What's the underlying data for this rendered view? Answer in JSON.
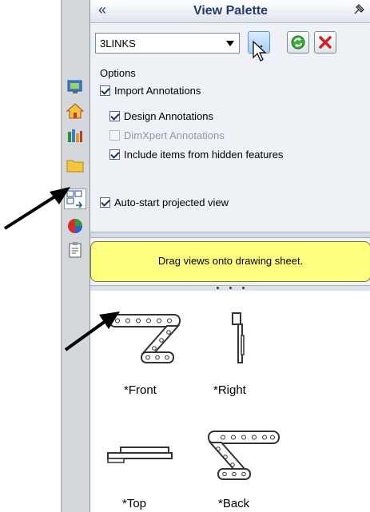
{
  "panel": {
    "title": "View Palette",
    "collapse_glyph": "«",
    "close_glyph": "✕",
    "pin_icon": "pushpin-icon"
  },
  "toolbar": {
    "drawing_dropdown": {
      "value": "3LINKS"
    },
    "buttons": [
      {
        "name": "browse-button",
        "icon": "ellipsis-icon",
        "tooltip": "..."
      },
      {
        "name": "refresh-button",
        "icon": "refresh-icon"
      },
      {
        "name": "clear-all-button",
        "icon": "red-x-icon"
      }
    ]
  },
  "options": {
    "label": "Options",
    "import_annotations": {
      "label": "Import Annotations",
      "checked": true
    },
    "design_annotations": {
      "label": "Design Annotations",
      "checked": true
    },
    "dimxpert_annotations": {
      "label": "DimXpert Annotations",
      "checked": false,
      "disabled": true
    },
    "include_hidden": {
      "label": "Include items from hidden features",
      "checked": true
    },
    "auto_start": {
      "label": "Auto-start projected view",
      "checked": true
    }
  },
  "hint": {
    "text": "Drag views onto drawing sheet."
  },
  "views": [
    {
      "label": "*Front",
      "icon": "front-view-thumbnail"
    },
    {
      "label": "*Right",
      "icon": "right-view-thumbnail"
    },
    {
      "label": "*Top",
      "icon": "top-view-thumbnail"
    },
    {
      "label": "*Back",
      "icon": "back-view-thumbnail"
    }
  ],
  "tabs": [
    {
      "name": "tab-solidworks-resources",
      "icon": "monitor-icon"
    },
    {
      "name": "tab-home",
      "icon": "house-icon"
    },
    {
      "name": "tab-design-library",
      "icon": "library-icon"
    },
    {
      "name": "tab-file-explorer",
      "icon": "folder-icon"
    },
    {
      "name": "tab-view-palette",
      "icon": "view-palette-icon",
      "active": true
    },
    {
      "name": "tab-appearances",
      "icon": "color-ball-icon"
    },
    {
      "name": "tab-custom-properties",
      "icon": "clipboard-icon"
    }
  ],
  "colors": {
    "title": "#213a70",
    "hint_bg": "#ffff80",
    "panel_bg": "#eef1f5"
  }
}
